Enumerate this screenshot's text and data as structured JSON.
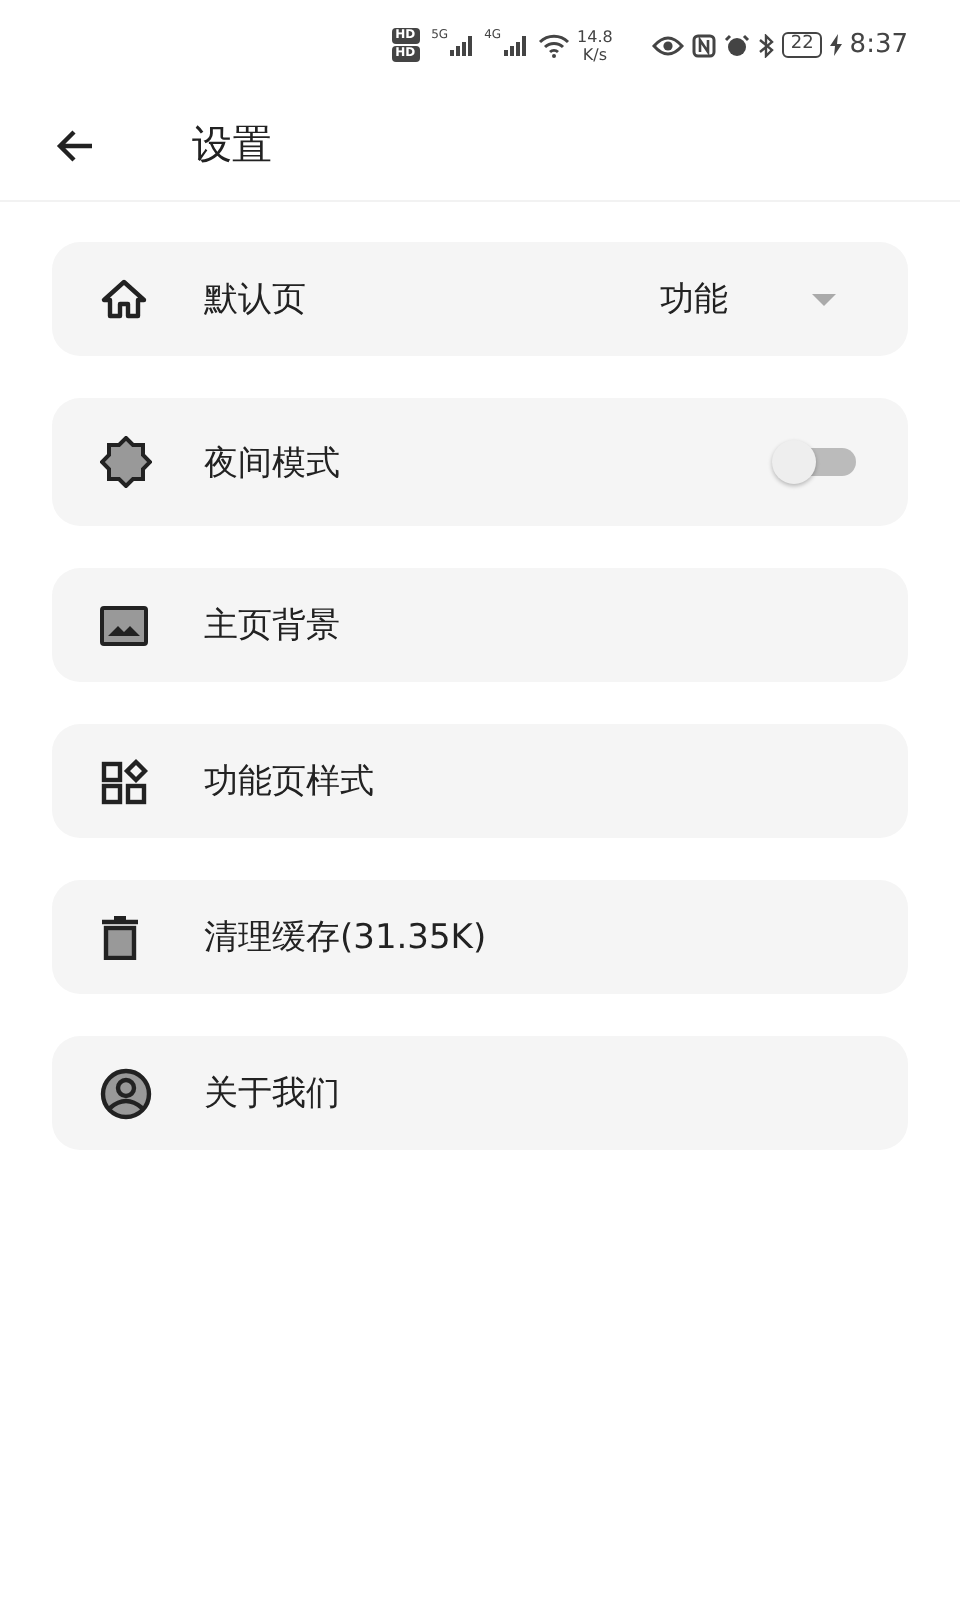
{
  "status_bar": {
    "sim_badges": [
      "HD",
      "HD"
    ],
    "networks": [
      "5G",
      "4G"
    ],
    "speed": [
      "14.8",
      "K/s"
    ],
    "battery": "22",
    "time": "8:37"
  },
  "header": {
    "title": "设置"
  },
  "items": [
    {
      "kind": "select",
      "label": "默认页",
      "value": "功能"
    },
    {
      "kind": "toggle",
      "label": "夜间模式",
      "on": false
    },
    {
      "kind": "link",
      "label": "主页背景"
    },
    {
      "kind": "link",
      "label": "功能页样式"
    },
    {
      "kind": "link",
      "label": "清理缓存(31.35K)"
    },
    {
      "kind": "link",
      "label": "关于我们"
    }
  ]
}
